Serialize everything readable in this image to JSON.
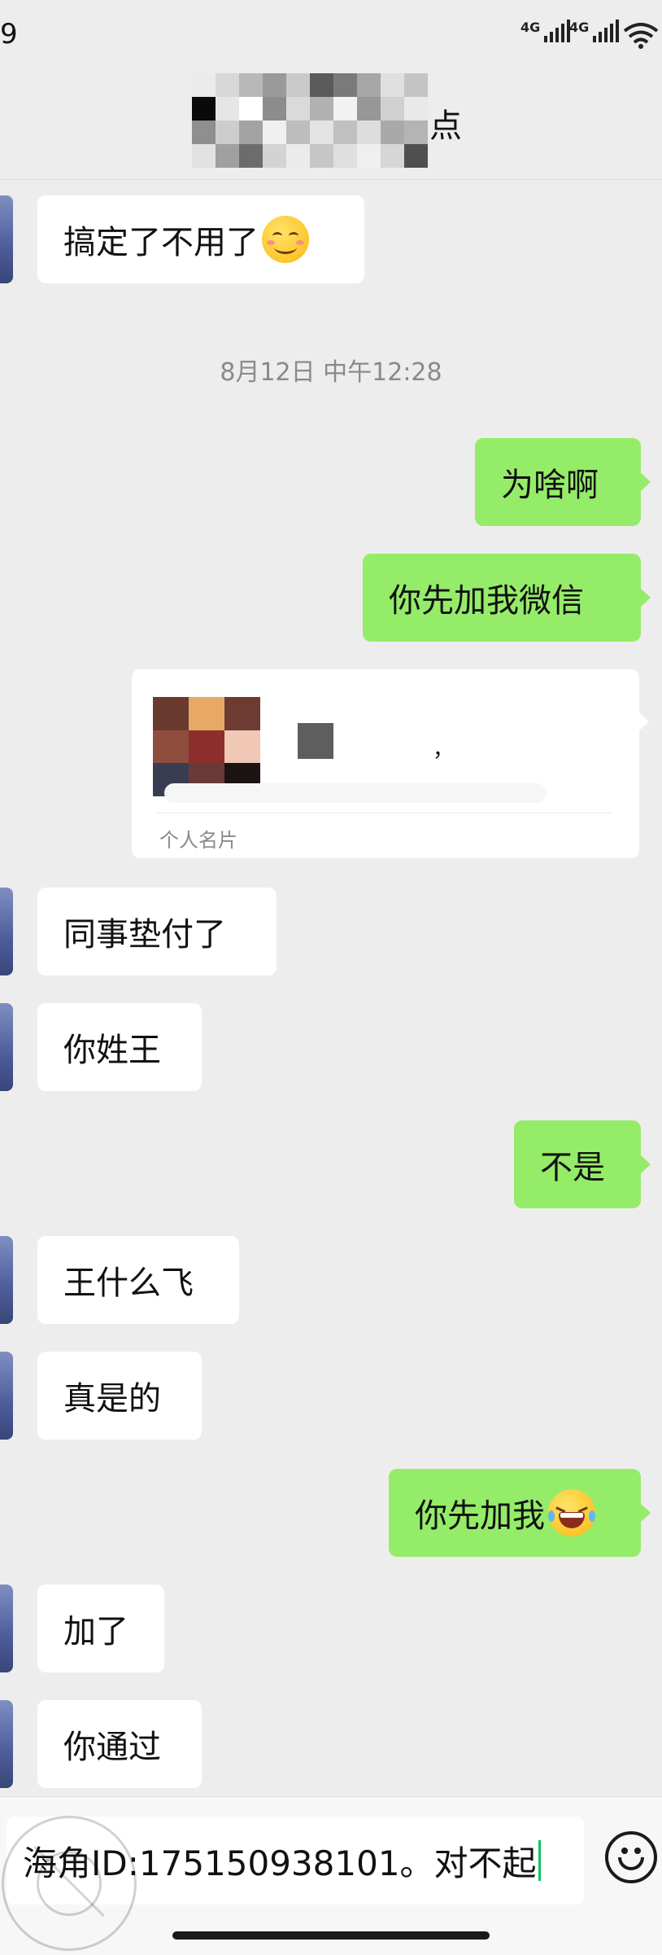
{
  "status_bar": {
    "time": "9",
    "network_1": "4G",
    "network_2": "4G",
    "icons": [
      "signal-icon",
      "signal-icon",
      "wifi-icon"
    ]
  },
  "header": {
    "title_visible": "点"
  },
  "messages": [
    {
      "side": "left",
      "text": "搞定了不用了",
      "emoji": "smiling-face-emoji"
    },
    {
      "type": "timestamp",
      "text": "8月12日 中午12:28"
    },
    {
      "side": "right",
      "text": "为啥啊"
    },
    {
      "side": "right",
      "text": "你先加我微信"
    },
    {
      "type": "contact_card",
      "side": "right",
      "label": "个人名片",
      "name_fragment": "，"
    },
    {
      "side": "left",
      "text": "同事垫付了"
    },
    {
      "side": "left",
      "text": "你姓王"
    },
    {
      "side": "right",
      "text": "不是"
    },
    {
      "side": "left",
      "text": "王什么飞"
    },
    {
      "side": "left",
      "text": "真是的"
    },
    {
      "side": "right",
      "text": "你先加我",
      "emoji": "laughing-tears-emoji"
    },
    {
      "side": "left",
      "text": "加了"
    },
    {
      "side": "left",
      "text": "你通过"
    }
  ],
  "input": {
    "value": "海角ID:175150938101。对不起",
    "emoji_button": "emoji-icon"
  },
  "colors": {
    "background": "#ededed",
    "bubble_self": "#95ec69",
    "bubble_other": "#ffffff",
    "caret": "#07c160"
  }
}
